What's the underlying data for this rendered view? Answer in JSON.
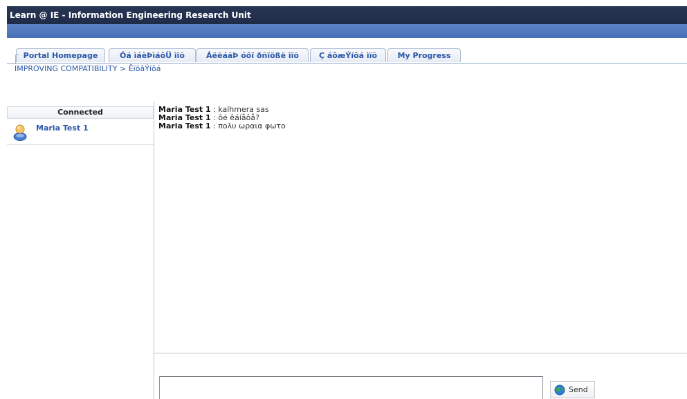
{
  "app": {
    "title": "Learn @ IE - Information Engineering Research Unit"
  },
  "tabs": [
    {
      "label": "Portal Homepage"
    },
    {
      "label": "Óá ìáèÞìáôÜ ìïõ"
    },
    {
      "label": "ÁëëáãÞ óôï ðñïößë ìïõ"
    },
    {
      "label": "Ç áôæÝíôá ìïõ"
    },
    {
      "label": "My Progress"
    }
  ],
  "breadcrumb": {
    "course": "IMPROVING COMPATIBILITY",
    "separator": " > ",
    "current": "ÊïõâÝíôá"
  },
  "connected": {
    "header": "Connected",
    "users": [
      {
        "name": "Maria Test 1",
        "icon": "user-icon"
      }
    ]
  },
  "chat": {
    "messages": [
      {
        "author": "Maria Test 1",
        "separator": " : ",
        "text": "kalhmera sas"
      },
      {
        "author": "Maria Test 1",
        "separator": " : ",
        "text": "ôé êáíåôå?"
      },
      {
        "author": "Maria Test 1",
        "separator": " : ",
        "text": "πολυ ωραια φωτο"
      }
    ],
    "input_value": "",
    "send_label": "Send",
    "send_icon": "send-globe-icon"
  }
}
